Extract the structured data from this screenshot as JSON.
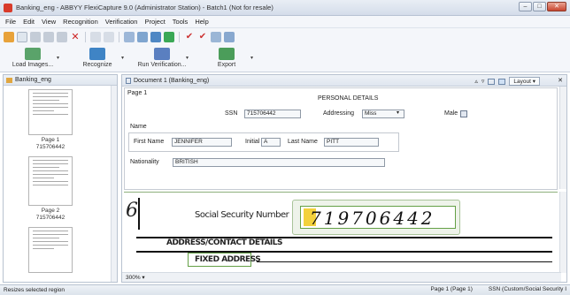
{
  "window": {
    "title": "Banking_eng - ABBYY FlexiCapture 9.0 (Administrator Station) - Batch1 (Not for resale)"
  },
  "menu": [
    "File",
    "Edit",
    "View",
    "Recognition",
    "Verification",
    "Project",
    "Tools",
    "Help"
  ],
  "toolbar2": {
    "load": "Load Images...",
    "recognize": "Recognize",
    "verify": "Run Verification...",
    "export": "Export"
  },
  "thumbs": {
    "header": "Banking_eng",
    "pages": [
      {
        "name": "Page 1",
        "id": "715706442"
      },
      {
        "name": "Page 2",
        "id": "715706442"
      }
    ]
  },
  "doc": {
    "header": "Document 1 (Banking_eng)",
    "layout": "Layout ▾",
    "page_label": "Page 1",
    "section_title": "PERSONAL DETAILS",
    "ssn_label": "SSN",
    "ssn_value": "715706442",
    "addressing_label": "Addressing",
    "addressing_value": "Miss",
    "male_label": "Male",
    "name_label": "Name",
    "first_name_label": "First Name",
    "first_name_value": "JENNIFER",
    "initial_label": "Initial",
    "initial_value": "A",
    "last_name_label": "Last Name",
    "last_name_value": "PITT",
    "nationality_label": "Nationality",
    "nationality_value": "BRITISH"
  },
  "image": {
    "left_num": "6",
    "ssn_caption": "Social Security Number",
    "ssn_digits": "719706442",
    "address_heading": "ADDRESS/CONTACT DETAILS",
    "fixed_address": "FIXED ADDRESS"
  },
  "zoom": "300%",
  "status": {
    "left": "Resizes selected region",
    "page": "Page 1 (Page 1)",
    "field": "SSN (Custom/Social Security I"
  }
}
